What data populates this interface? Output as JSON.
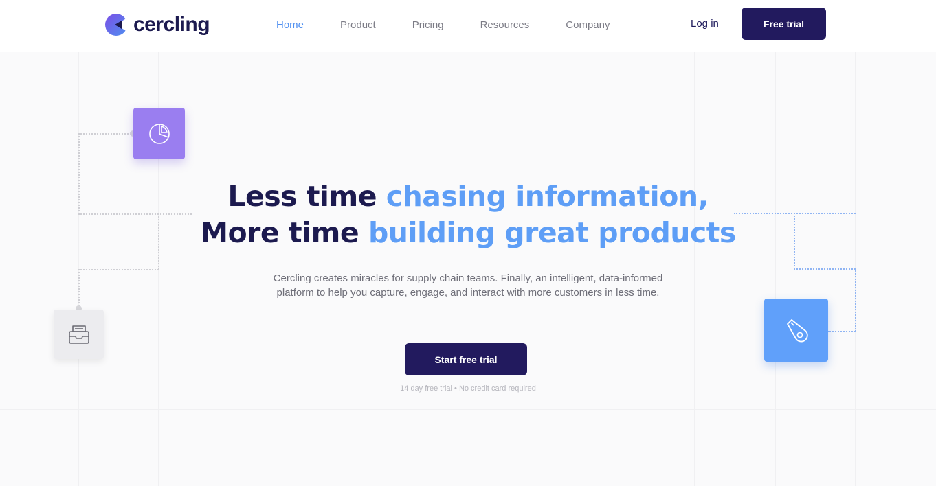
{
  "brand": {
    "name": "cercling"
  },
  "nav": {
    "items": [
      {
        "label": "Home",
        "active": true
      },
      {
        "label": "Product",
        "active": false
      },
      {
        "label": "Pricing",
        "active": false
      },
      {
        "label": "Resources",
        "active": false
      },
      {
        "label": "Company",
        "active": false
      }
    ],
    "login_label": "Log in",
    "trial_label": "Free trial"
  },
  "hero": {
    "line1_dark": "Less time ",
    "line1_blue": "chasing information,",
    "line2_dark": "More time ",
    "line2_blue": "building great products",
    "subtitle": "Cercling creates miracles for supply chain teams. Finally, an intelligent, data-informed platform to help you capture, engage, and interact with more customers in less time.",
    "cta_label": "Start free trial",
    "fineprint": "14 day free trial • No credit card required"
  },
  "tiles": [
    {
      "icon": "pie-chart-icon",
      "color": "#9a7ef0"
    },
    {
      "icon": "inbox-tray-icon",
      "color": "#ececef"
    },
    {
      "icon": "whistle-icon",
      "color": "#60a0fa"
    }
  ],
  "colors": {
    "primary": "#221a5e",
    "accent": "#5e9ef6",
    "heading": "#1c1a4f"
  }
}
